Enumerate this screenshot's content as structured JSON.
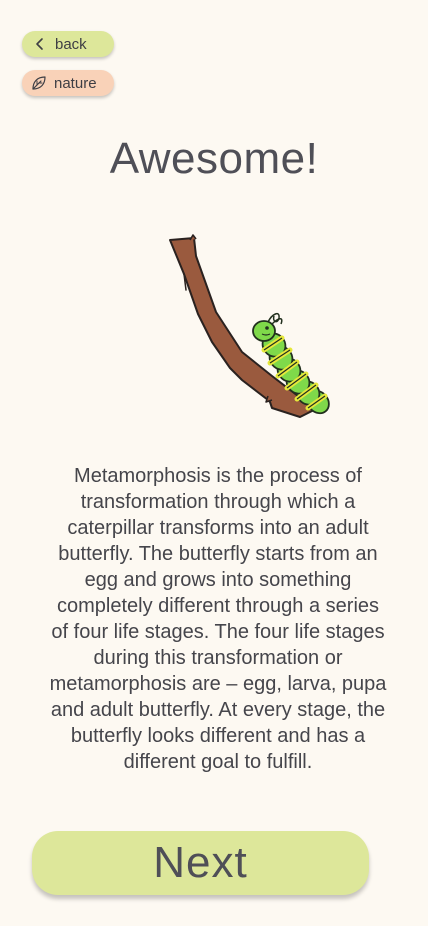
{
  "nav": {
    "back_label": "back",
    "back_icon": "chevron-left-icon",
    "category_label": "nature",
    "category_icon": "leaf-icon"
  },
  "page": {
    "title": "Awesome!",
    "illustration": "caterpillar-on-branch",
    "description": "Metamorphosis is the process of transformation through which a caterpillar transforms into an adult butterfly. The butterfly starts from an egg and grows into something completely different through a series of four life stages. The four life stages during this transformation or metamorphosis are – egg, larva, pupa and adult butterfly. At every stage, the butterfly looks different and has a different goal to fulfill.",
    "next_label": "Next"
  },
  "colors": {
    "background": "#fdf9f2",
    "accent_green": "#dde79a",
    "accent_peach": "#f9d2b8",
    "text": "#4f4f57"
  }
}
